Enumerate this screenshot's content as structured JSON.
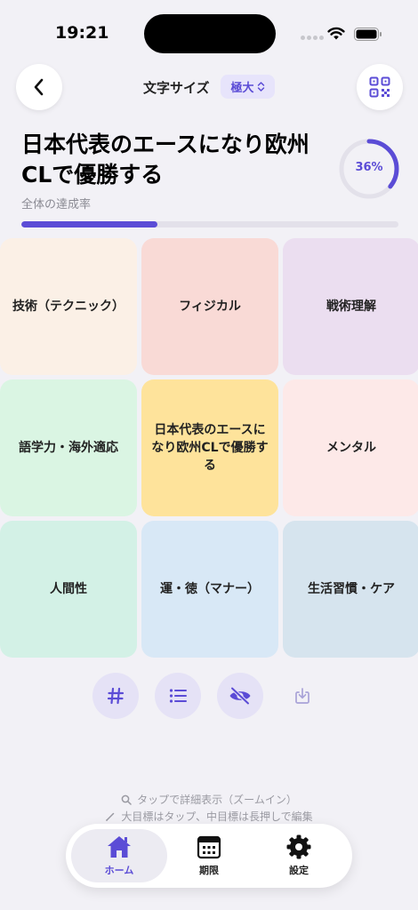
{
  "status_bar": {
    "time": "19:21"
  },
  "header": {
    "font_size_label": "文字サイズ",
    "font_size_value": "極大",
    "back_icon": "chevron-left-icon",
    "qr_icon": "qr-code-icon"
  },
  "goal": {
    "title": "日本代表のエースになり欧州CLで優勝する",
    "progress_percent_label": "36%",
    "progress_fraction": 0.36,
    "rate_label": "全体の達成率"
  },
  "grid": {
    "cells": [
      {
        "label": "技術（テクニック）",
        "color": "#fbf0e6"
      },
      {
        "label": "フィジカル",
        "color": "#f9dad6"
      },
      {
        "label": "戦術理解",
        "color": "#ebdef0"
      },
      {
        "label": "語学力・海外適応",
        "color": "#daf5e3"
      },
      {
        "label": "日本代表のエースになり欧州CLで優勝する",
        "color": "#fee39b"
      },
      {
        "label": "メンタル",
        "color": "#fde9e8"
      },
      {
        "label": "人間性",
        "color": "#d3f1e6"
      },
      {
        "label": "運・徳（マナー）",
        "color": "#d8e8f6"
      },
      {
        "label": "生活習慣・ケア",
        "color": "#d6e4ee"
      }
    ]
  },
  "toolbar": {
    "icons": [
      "hash-icon",
      "list-icon",
      "eye-slash-icon",
      "download-icon"
    ]
  },
  "hints": {
    "tap_hint": "タップで詳細表示（ズームイン）",
    "edit_hint": "大目標はタップ、中目標は長押しで編集"
  },
  "tabs": [
    {
      "label": "ホーム",
      "icon": "home-icon",
      "active": true
    },
    {
      "label": "期限",
      "icon": "calendar-icon",
      "active": false
    },
    {
      "label": "設定",
      "icon": "gear-icon",
      "active": false
    }
  ],
  "colors": {
    "accent": "#5b4cd6",
    "background": "#f2f1f6"
  }
}
